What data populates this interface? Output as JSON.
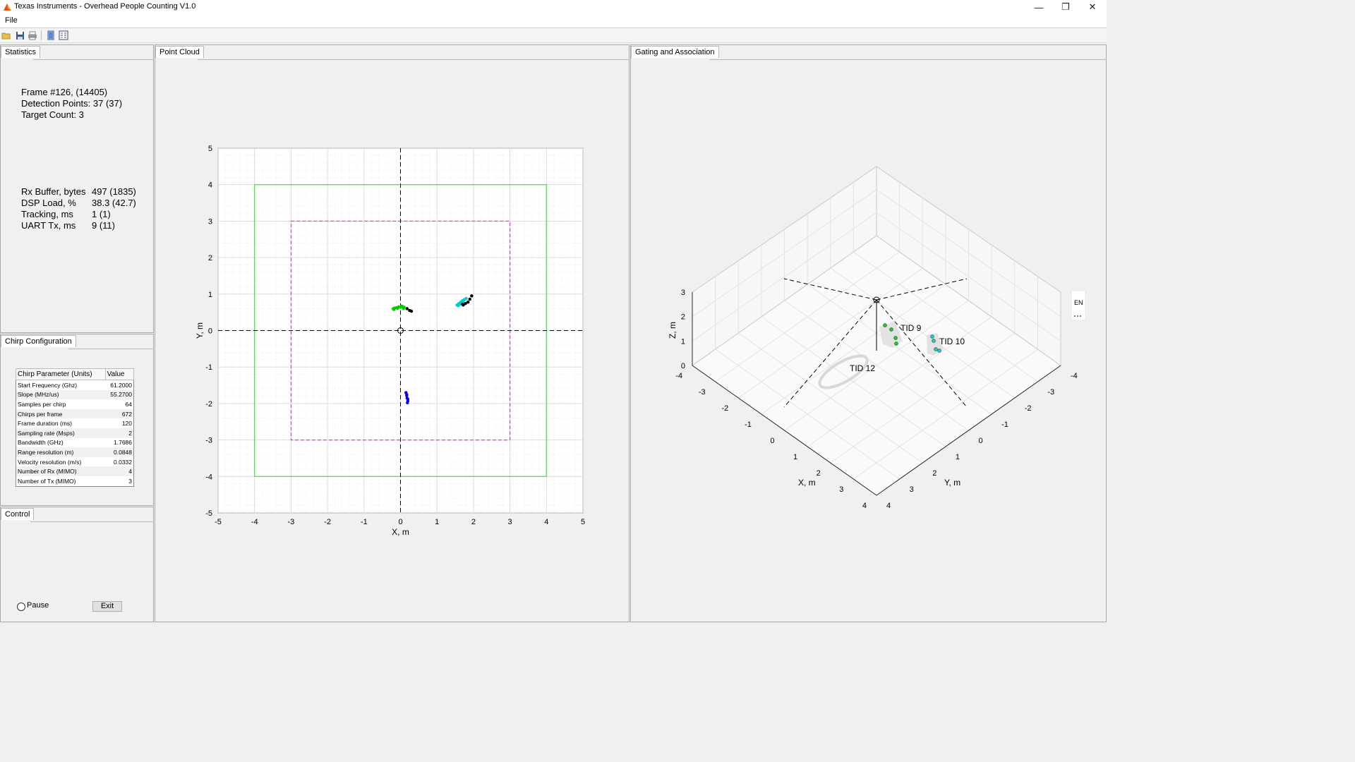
{
  "window": {
    "title": "Texas Instruments - Overhead People Counting V1.0",
    "min_glyph": "—",
    "max_glyph": "❐",
    "close_glyph": "✕"
  },
  "menu": {
    "file": "File"
  },
  "statistics": {
    "tab": "Statistics",
    "frame": "Frame #126, (14405)",
    "detection_points": "Detection Points: 37 (37)",
    "target_count": "Target Count: 3",
    "metrics": [
      {
        "label": "Rx Buffer, bytes",
        "value": "497 (1835)"
      },
      {
        "label": "DSP Load, %",
        "value": "38.3 (42.7)"
      },
      {
        "label": "Tracking, ms",
        "value": "1 (1)"
      },
      {
        "label": "UART Tx, ms",
        "value": "9 (11)"
      }
    ]
  },
  "chirp": {
    "tab": "Chirp Configuration",
    "header_param": "Chirp Parameter (Units)",
    "header_value": "Value",
    "rows": [
      {
        "param": "Start Frequency (Ghz)",
        "value": "61.2000"
      },
      {
        "param": "Slope (MHz/us)",
        "value": "55.2700"
      },
      {
        "param": "Samples per chirp",
        "value": "64"
      },
      {
        "param": "Chirps per frame",
        "value": "672"
      },
      {
        "param": "Frame duration (ms)",
        "value": "120"
      },
      {
        "param": "Sampling rate (Msps)",
        "value": "2"
      },
      {
        "param": "Bandwidth (GHz)",
        "value": "1.7686"
      },
      {
        "param": "Range resolution (m)",
        "value": "0.0848"
      },
      {
        "param": "Velocity resolution (m/s)",
        "value": "0.0332"
      },
      {
        "param": "Number of Rx (MIMO)",
        "value": "4"
      },
      {
        "param": "Number of Tx (MIMO)",
        "value": "3"
      }
    ]
  },
  "control": {
    "tab": "Control",
    "pause": "Pause",
    "exit": "Exit"
  },
  "point_cloud": {
    "tab": "Point Cloud",
    "chart_data": {
      "type": "scatter",
      "xlabel": "X, m",
      "ylabel": "Y, m",
      "xlim": [
        -5,
        5
      ],
      "ylim": [
        -5,
        5
      ],
      "xticks": [
        -5,
        -4,
        -3,
        -2,
        -1,
        0,
        1,
        2,
        3,
        4,
        5
      ],
      "yticks": [
        -5,
        -4,
        -3,
        -2,
        -1,
        0,
        1,
        2,
        3,
        4,
        5
      ],
      "grid": true,
      "boundary_box": {
        "x": [
          -4,
          4
        ],
        "y": [
          -4,
          4
        ],
        "color": "#33ee33"
      },
      "static_box": {
        "x": [
          -3,
          3
        ],
        "y": [
          -3,
          3
        ],
        "color": "#ee33ee"
      },
      "series": [
        {
          "color": "#00cc00",
          "points": [
            [
              -0.2,
              0.6
            ],
            [
              -0.15,
              0.62
            ],
            [
              -0.1,
              0.63
            ],
            [
              -0.05,
              0.65
            ],
            [
              0.0,
              0.64
            ],
            [
              0.05,
              0.66
            ],
            [
              0.1,
              0.64
            ],
            [
              -0.18,
              0.58
            ],
            [
              0.08,
              0.6
            ],
            [
              0.03,
              0.67
            ],
            [
              -0.08,
              0.61
            ]
          ]
        },
        {
          "color": "#00cccc",
          "points": [
            [
              1.55,
              0.7
            ],
            [
              1.6,
              0.74
            ],
            [
              1.65,
              0.78
            ],
            [
              1.7,
              0.82
            ],
            [
              1.75,
              0.85
            ],
            [
              1.68,
              0.76
            ],
            [
              1.62,
              0.72
            ],
            [
              1.72,
              0.8
            ],
            [
              1.58,
              0.68
            ],
            [
              1.8,
              0.88
            ]
          ]
        },
        {
          "color": "#0000ee",
          "points": [
            [
              0.15,
              -1.7
            ],
            [
              0.17,
              -1.78
            ],
            [
              0.18,
              -1.85
            ],
            [
              0.2,
              -1.93
            ],
            [
              0.19,
              -1.98
            ],
            [
              0.17,
              -1.75
            ],
            [
              0.2,
              -1.88
            ]
          ]
        },
        {
          "color": "#000000",
          "points": [
            [
              0.18,
              0.6
            ],
            [
              0.25,
              0.55
            ],
            [
              0.3,
              0.53
            ],
            [
              1.7,
              0.72
            ],
            [
              1.78,
              0.74
            ],
            [
              1.85,
              0.78
            ],
            [
              1.9,
              0.86
            ],
            [
              1.95,
              0.95
            ],
            [
              1.72,
              0.7
            ]
          ]
        }
      ]
    }
  },
  "gating": {
    "tab": "Gating and Association",
    "chart_data": {
      "type": "scatter",
      "xlabel": "X, m",
      "ylabel": "Y, m",
      "zlabel": "Z, m",
      "xticks": [
        -4,
        -3,
        -2,
        -1,
        0,
        1,
        2,
        3,
        4
      ],
      "yticks": [
        -4,
        -3,
        -2,
        -1,
        0,
        1,
        2,
        3,
        4
      ],
      "zticks": [
        0,
        1,
        2,
        3
      ],
      "targets": [
        {
          "label": "TID 9",
          "color": "#22cc22"
        },
        {
          "label": "TID 10",
          "color": "#22cccc"
        },
        {
          "label": "TID 12",
          "color": "#2222ee"
        }
      ],
      "legend": [
        "EN"
      ]
    }
  }
}
